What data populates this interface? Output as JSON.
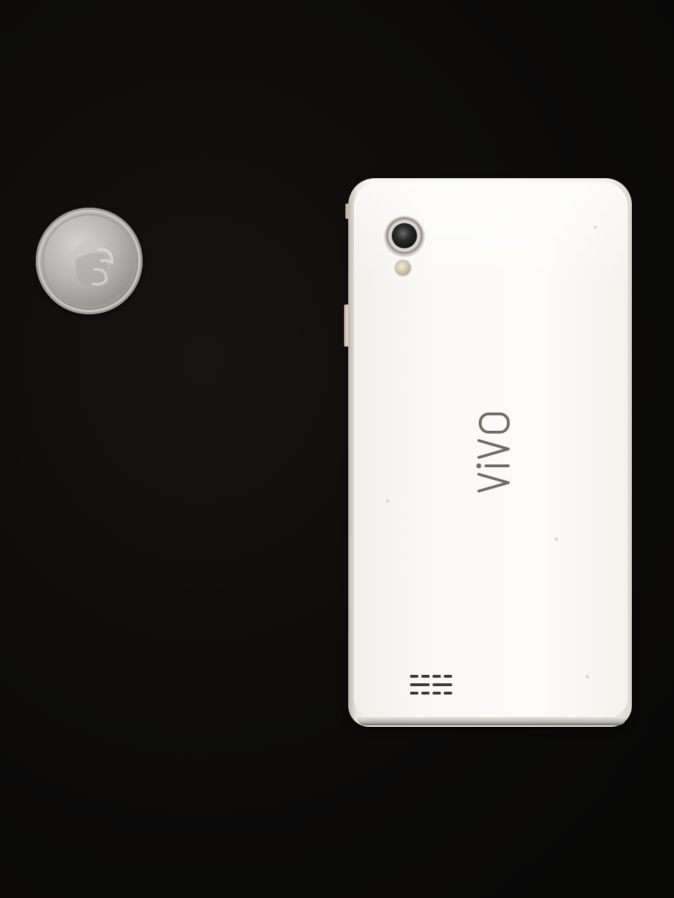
{
  "scene": {
    "background_color": "#0d0c0b",
    "objects": [
      {
        "name": "coin",
        "color": "#b5b4b0"
      },
      {
        "name": "phone",
        "color": "#f9f8f4"
      }
    ]
  },
  "phone": {
    "brand_logo_text": "vivo",
    "logo_color": "#6e6b66",
    "body_color": "#f9f8f4",
    "button_color": "#e6d5cd"
  },
  "coin": {
    "color": "#b5b4b0"
  }
}
